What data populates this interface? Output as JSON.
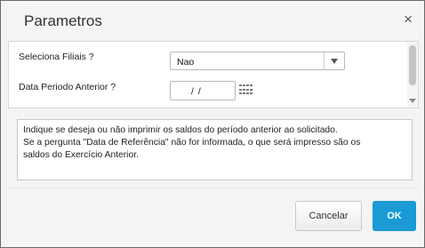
{
  "dialog": {
    "title": "Parametros",
    "close_glyph": "×"
  },
  "params": [
    {
      "label": "Seleciona Filiais ?",
      "type": "select",
      "value": "Nao"
    },
    {
      "label": "Data Periodo Anterior ?",
      "type": "date",
      "value": "/ /"
    }
  ],
  "help": {
    "lines": [
      "Indique se deseja ou não imprimir os saldos do período anterior ao solicitado.",
      "Se a pergunta \"Data de Referência\" não for informada, o que será impresso são os",
      "saldos do Exercício Anterior."
    ]
  },
  "buttons": {
    "cancel": "Cancelar",
    "ok": "OK"
  },
  "colors": {
    "ok_button": "#1a9bd6",
    "background": "#f4f4f4"
  }
}
